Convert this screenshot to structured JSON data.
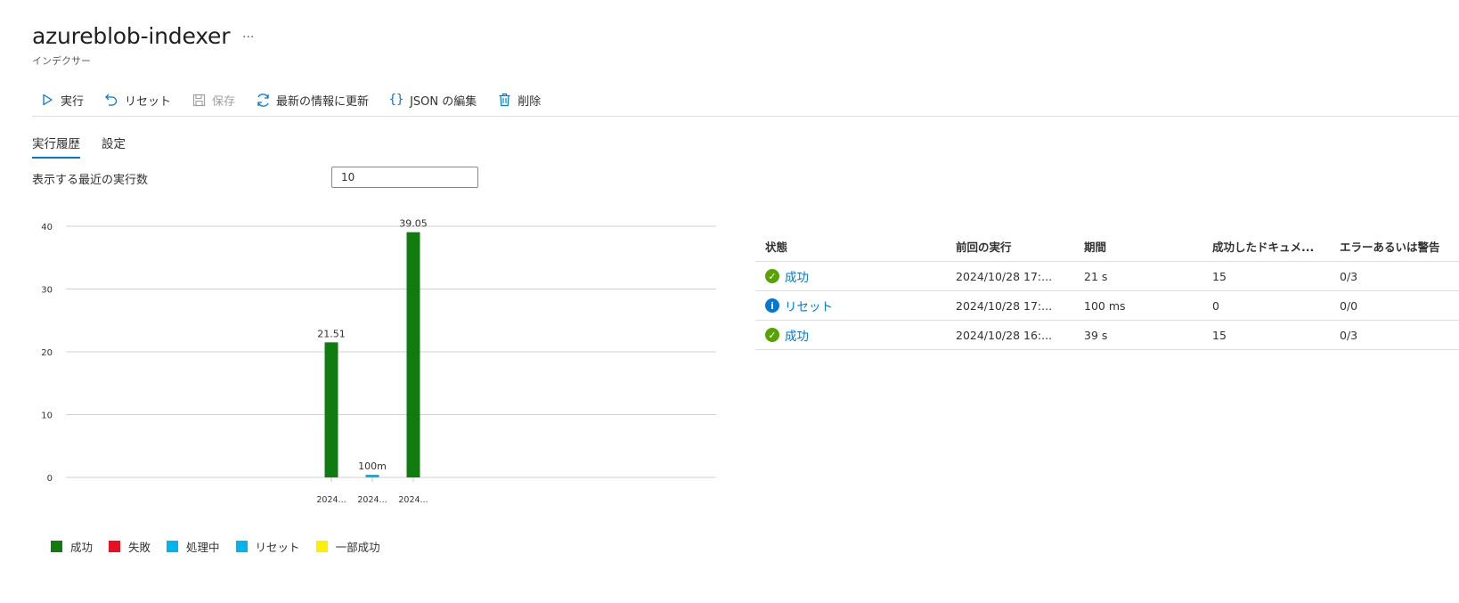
{
  "header": {
    "title": "azureblob-indexer",
    "more": "···",
    "subtitle": "インデクサー"
  },
  "toolbar": {
    "run": "実行",
    "reset": "リセット",
    "save": "保存",
    "refresh": "最新の情報に更新",
    "edit_json": "JSON の編集",
    "delete": "削除"
  },
  "tabs": {
    "history": "実行履歴",
    "settings": "設定"
  },
  "run_count": {
    "label": "表示する最近の実行数",
    "value": "10"
  },
  "colors": {
    "success": "#107c10",
    "failed": "#e81123",
    "in_progress": "#00b4f0",
    "reset": "#00b4f0",
    "partial": "#fcf000",
    "link": "#0078d4"
  },
  "chart_data": {
    "type": "bar",
    "categories": [
      "2024...",
      "2024...",
      "2024..."
    ],
    "values": [
      21.51,
      0.1,
      39.05
    ],
    "value_labels": [
      "21.51",
      "100m",
      "39.05"
    ],
    "series_status": [
      "success",
      "reset",
      "success"
    ],
    "ylim": [
      0,
      40
    ],
    "yticks": [
      "0",
      "10",
      "20",
      "30",
      "40"
    ],
    "grid": true,
    "legend_position": "bottom-left"
  },
  "legend": [
    "成功",
    "失敗",
    "処理中",
    "リセット",
    "一部成功"
  ],
  "table": {
    "headers": [
      "状態",
      "前回の実行",
      "期間",
      "成功したドキュメ...",
      "エラーあるいは警告"
    ],
    "rows": [
      {
        "status": "成功",
        "status_type": "success",
        "last_run": "2024/10/28 17:...",
        "duration": "21 s",
        "docs": "15",
        "errors": "0/3"
      },
      {
        "status": "リセット",
        "status_type": "info",
        "last_run": "2024/10/28 17:...",
        "duration": "100 ms",
        "docs": "0",
        "errors": "0/0"
      },
      {
        "status": "成功",
        "status_type": "success",
        "last_run": "2024/10/28 16:...",
        "duration": "39 s",
        "docs": "15",
        "errors": "0/3"
      }
    ]
  }
}
